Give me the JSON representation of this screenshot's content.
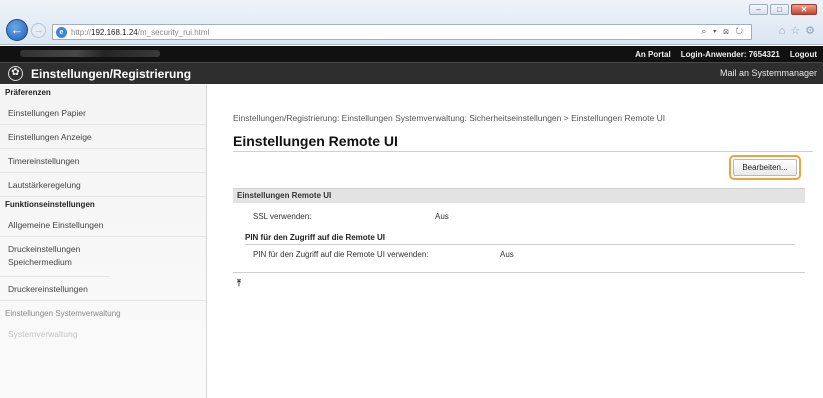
{
  "browser": {
    "url_prefix": "http://",
    "url_host": "192.168.1.24",
    "url_path": "/m_security_rui.html",
    "address_right": "⌕ ▾ ⊠ ↻",
    "window_buttons": [
      "–",
      "□",
      "✕"
    ],
    "toolbar_icons": [
      "⌂",
      "☆",
      "⚙"
    ]
  },
  "topbar": {
    "portal_link": "An Portal",
    "login_label": "Login-Anwender:",
    "login_user": "7654321",
    "logout_link": "Logout"
  },
  "header": {
    "title": "Einstellungen/Registrierung",
    "mail_link": "Mail an Systemmanager",
    "icon": "settings-icon"
  },
  "sidebar": {
    "sections": [
      {
        "heading": "Präferenzen",
        "items": [
          "Einstellungen Papier",
          "Einstellungen Anzeige",
          "Timereinstellungen",
          "Lautstärkeregelung"
        ]
      },
      {
        "heading": "Funktionseinstellungen",
        "items": [
          "Allgemeine Einstellungen",
          "Druckeinstellungen Speichermedium",
          "Druckereinstellungen"
        ]
      },
      {
        "heading": "Einstellungen Systemverwaltung",
        "items": [
          "Systemverwaltung"
        ]
      }
    ]
  },
  "main": {
    "breadcrumb": "Einstellungen/Registrierung: Einstellungen Systemverwaltung: Sicherheitseinstellungen > Einstellungen Remote UI",
    "title": "Einstellungen Remote UI",
    "edit_button": "Bearbeiten...",
    "section_header": "Einstellungen Remote UI",
    "ssl_label": "SSL verwenden:",
    "ssl_value": "Aus",
    "pin_heading": "PIN für den Zugriff auf die Remote UI",
    "pin_label": "PIN für den Zugriff auf die Remote UI verwenden:",
    "pin_value": "Aus",
    "top_link": "⤒"
  }
}
